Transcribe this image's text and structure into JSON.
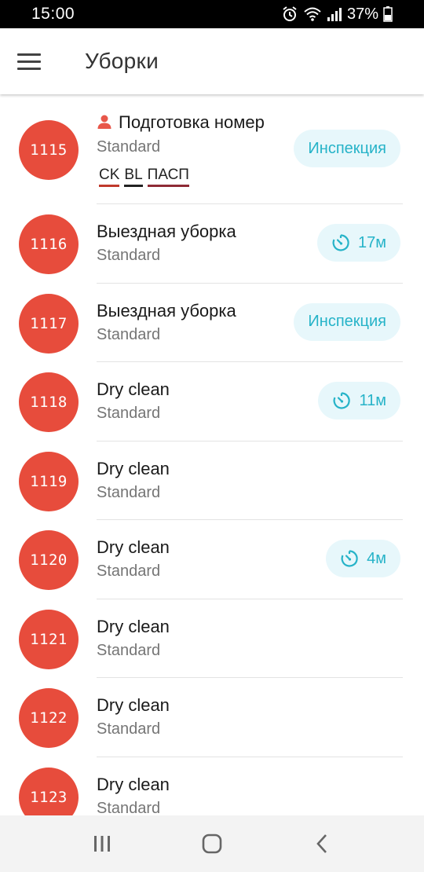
{
  "status_bar": {
    "time": "15:00",
    "battery_percent": "37%",
    "icons": [
      "alarm-icon",
      "wifi-icon",
      "signal-icon",
      "battery-icon"
    ]
  },
  "app_bar": {
    "title": "Уборки",
    "menu_icon": "hamburger-menu-icon"
  },
  "colors": {
    "badge": "#e74c3c",
    "pill_bg": "#e7f7fb",
    "pill_text": "#26b3c8",
    "person_icon": "#e8574a"
  },
  "rooms": [
    {
      "number": "1115",
      "title": "Подготовка номер",
      "subtitle": "Standard",
      "has_person_icon": true,
      "tags": [
        "CK",
        "BL",
        "ПАСП"
      ],
      "pill": {
        "type": "text",
        "label": "Инспекция"
      }
    },
    {
      "number": "1116",
      "title": "Выездная уборка",
      "subtitle": "Standard",
      "pill": {
        "type": "timer",
        "label": "17м"
      }
    },
    {
      "number": "1117",
      "title": "Выездная уборка",
      "subtitle": "Standard",
      "pill": {
        "type": "text",
        "label": "Инспекция"
      }
    },
    {
      "number": "1118",
      "title": "Dry clean",
      "subtitle": "Standard",
      "pill": {
        "type": "timer",
        "label": "11м"
      }
    },
    {
      "number": "1119",
      "title": "Dry clean",
      "subtitle": "Standard"
    },
    {
      "number": "1120",
      "title": "Dry clean",
      "subtitle": "Standard",
      "pill": {
        "type": "timer",
        "label": "4м"
      }
    },
    {
      "number": "1121",
      "title": "Dry clean",
      "subtitle": "Standard"
    },
    {
      "number": "1122",
      "title": "Dry clean",
      "subtitle": "Standard"
    },
    {
      "number": "1123",
      "title": "Dry clean",
      "subtitle": "Standard"
    }
  ],
  "nav_bar": {
    "buttons": [
      "recent-apps-icon",
      "home-icon",
      "back-icon"
    ]
  }
}
